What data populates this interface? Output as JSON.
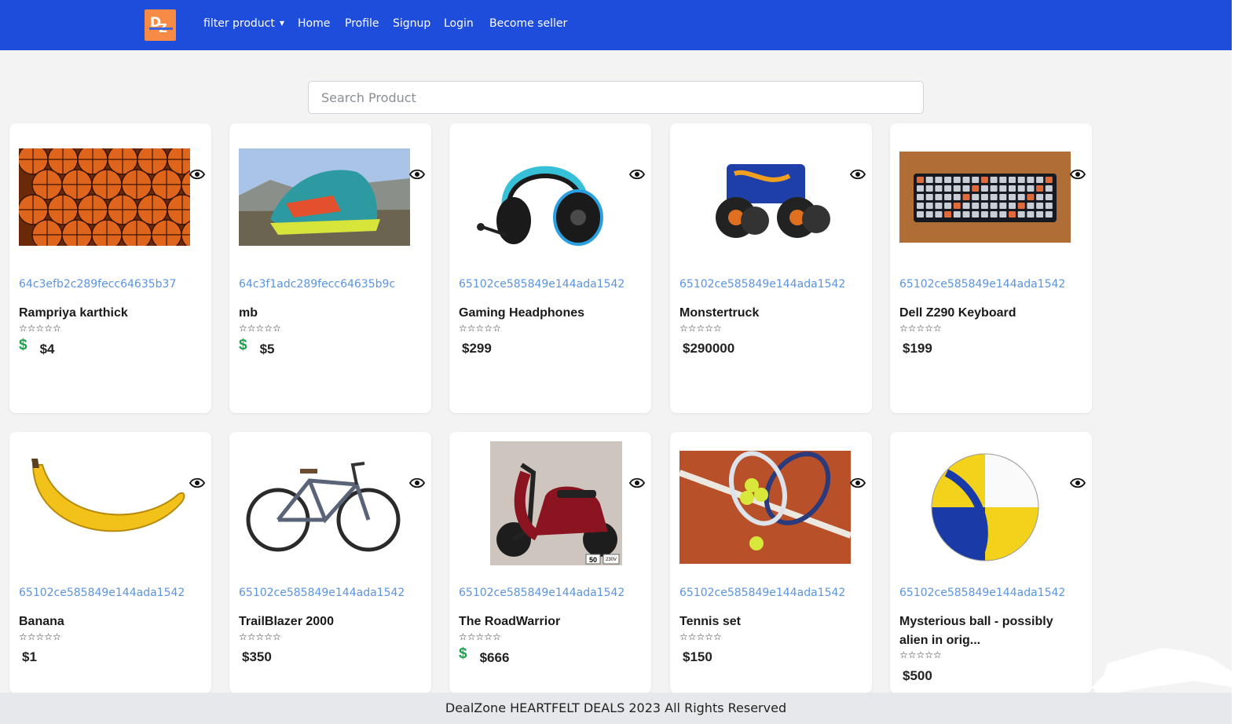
{
  "navbar": {
    "brand_color": "#1e4ddb",
    "logo_letters": [
      "D",
      "Z"
    ],
    "filter_label": "filter product",
    "links": [
      "Home",
      "Profile",
      "Signup",
      "Login",
      "Become seller"
    ]
  },
  "search": {
    "placeholder": "Search Product",
    "value": ""
  },
  "products": [
    {
      "id": "64c3efb2c289fecc64635b37",
      "name": "Rampriya karthick",
      "rating": "☆☆☆☆☆",
      "price": "$4",
      "dollar_icon": true,
      "image": "basketballs"
    },
    {
      "id": "64c3f1adc289fecc64635b9c",
      "name": "mb",
      "rating": "☆☆☆☆☆",
      "price": "$5",
      "dollar_icon": true,
      "image": "running-shoe"
    },
    {
      "id": "65102ce585849e144ada1542",
      "name": "Gaming Headphones",
      "rating": "☆☆☆☆☆",
      "price": "$299",
      "dollar_icon": false,
      "image": "headphones"
    },
    {
      "id": "65102ce585849e144ada1542",
      "name": "Monstertruck",
      "rating": "☆☆☆☆☆",
      "price": "$290000",
      "dollar_icon": false,
      "image": "monster-truck"
    },
    {
      "id": "65102ce585849e144ada1542",
      "name": "Dell Z290 Keyboard",
      "rating": "☆☆☆☆☆",
      "price": "$199",
      "dollar_icon": false,
      "image": "keyboard"
    },
    {
      "id": "65102ce585849e144ada1542",
      "name": "Banana",
      "rating": "☆☆☆☆☆",
      "price": "$1",
      "dollar_icon": false,
      "image": "banana"
    },
    {
      "id": "65102ce585849e144ada1542",
      "name": "TrailBlazer 2000",
      "rating": "☆☆☆☆☆",
      "price": "$350",
      "dollar_icon": false,
      "image": "bicycle"
    },
    {
      "id": "65102ce585849e144ada1542",
      "name": "The RoadWarrior",
      "rating": "☆☆☆☆☆",
      "price": "$666",
      "dollar_icon": true,
      "image": "scooter"
    },
    {
      "id": "65102ce585849e144ada1542",
      "name": "Tennis set",
      "rating": "☆☆☆☆☆",
      "price": "$150",
      "dollar_icon": false,
      "image": "tennis"
    },
    {
      "id": "65102ce585849e144ada1542",
      "name": "Mysterious ball - possibly alien in orig...",
      "rating": "☆☆☆☆☆",
      "price": "$500",
      "dollar_icon": false,
      "image": "volleyball"
    }
  ],
  "scooter_tags": [
    "50",
    "230V"
  ],
  "footer": {
    "text": "DealZone HEARTFELT DEALS 2023 All Rights Reserved"
  },
  "colors": {
    "id_link": "#5b94e0",
    "dollar_green": "#1aa34a",
    "logo_orange": "#f68b45"
  }
}
